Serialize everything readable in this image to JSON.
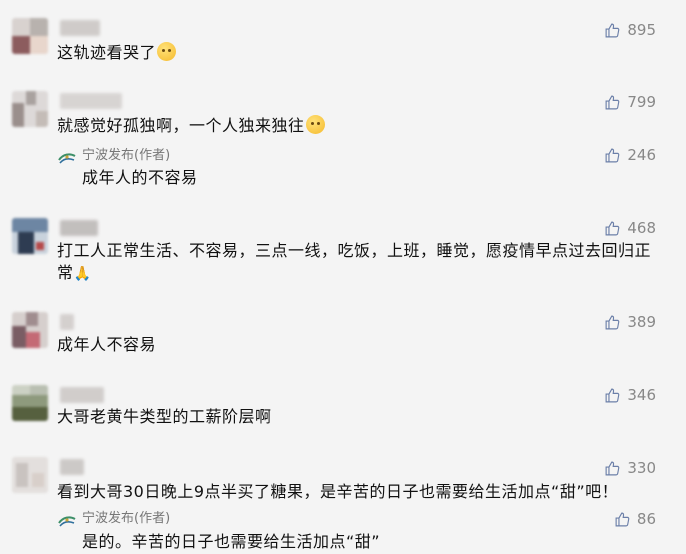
{
  "comments": [
    {
      "text": "这轨迹看哭了",
      "emoji": "crying-face",
      "likes": "895"
    },
    {
      "text": "就感觉好孤独啊，一个人独来独往",
      "emoji": "melting-face",
      "likes": "799",
      "reply": {
        "author": "宁波发布(作者)",
        "text": "成年人的不容易",
        "likes": "246"
      }
    },
    {
      "text_line1": "打工人正常生活、不容易，三点一线，吃饭，上班，睡觉，愿疫情早点过去回归正",
      "text_line2": "常",
      "emoji": "praying-hands",
      "likes": "468"
    },
    {
      "text": "成年人不容易",
      "likes": "389"
    },
    {
      "text": "大哥老黄牛类型的工薪阶层啊",
      "likes": "346"
    },
    {
      "text": "看到大哥30日晚上9点半买了糖果，是辛苦的日子也需要给生活加点“甜”吧！",
      "likes": "330",
      "reply": {
        "author": "宁波发布(作者)",
        "text": "是的。辛苦的日子也需要给生活加点“甜”",
        "likes": "86"
      }
    }
  ]
}
